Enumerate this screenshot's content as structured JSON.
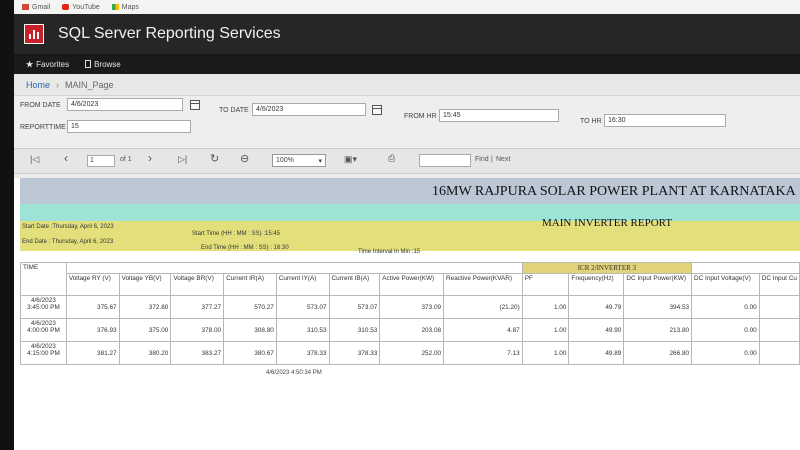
{
  "bookmarks": [
    "Gmail",
    "YouTube",
    "Maps"
  ],
  "app_title": "SQL Server Reporting Services",
  "nav": {
    "favorites": "Favorites",
    "browse": "Browse"
  },
  "breadcrumb": {
    "home": "Home",
    "current": "MAIN_Page"
  },
  "params": {
    "from_date_label": "FROM DATE",
    "from_date": "4/6/2023",
    "to_date_label": "TO DATE",
    "to_date": "4/6/2023",
    "from_hr_label": "FROM HR",
    "from_hr": "15:45",
    "to_hr_label": "TO HR",
    "to_hr": "16:30",
    "reporttime_label": "REPORTTIME",
    "reporttime": "15"
  },
  "toolbar": {
    "page": "1",
    "of": "of 1",
    "zoom": "100%",
    "find": "Find",
    "next": "Next",
    "sep": "|"
  },
  "report": {
    "title": "16MW RAJPURA SOLAR POWER PLANT AT KARNATAKA",
    "subtitle": "MAIN INVERTER  REPORT",
    "start_date": "Start Date :Thursday, April 6, 2023",
    "end_date": "End  Date : Thursday, April 6, 2023",
    "start_time": "Start Time (HH : MM : SS) :15:45",
    "end_time": "End Time (HH : MM : SS) : 16:30",
    "interval": "Time Interval in Min  :15",
    "group": "ICR 2/INVERTER 3",
    "columns": [
      "TIME",
      "Voltage RY (V)",
      "Voltage YB(V)",
      "Voltage BR(V)",
      "Current IR(A)",
      "Current IY(A)",
      "Current IB(A)",
      "Active Power(KW)",
      "Reactive Power(KVAR)",
      "PF",
      "Frequency(Hz)",
      "DC Input Power(KW)",
      "DC Input Voltage(V)",
      "DC Input Cu"
    ],
    "rows": [
      {
        "time": "4/6/2023 3:45:00 PM",
        "vry": "375.67",
        "vyb": "372.80",
        "vbr": "377.27",
        "ir": "570.27",
        "iy": "573.07",
        "ib": "573.07",
        "ap": "373.09",
        "rp": "(21.20)",
        "pf": "1.00",
        "freq": "49.79",
        "dcp": "394.53",
        "dcv": "0.00"
      },
      {
        "time": "4/6/2023 4:00:00 PM",
        "vry": "376.93",
        "vyb": "375.00",
        "vbr": "378.00",
        "ir": "308.80",
        "iy": "310.53",
        "ib": "310.53",
        "ap": "203.08",
        "rp": "4.87",
        "pf": "1.00",
        "freq": "49.90",
        "dcp": "213.80",
        "dcv": "0.00"
      },
      {
        "time": "4/6/2023 4:15:00 PM",
        "vry": "381.27",
        "vyb": "380.20",
        "vbr": "383.27",
        "ir": "380.67",
        "iy": "378.33",
        "ib": "378.33",
        "ap": "252.00",
        "rp": "7.13",
        "pf": "1.00",
        "freq": "49.89",
        "dcp": "266.80",
        "dcv": "0.00"
      }
    ],
    "generated": "4/6/2023 4:50:34 PM"
  },
  "colors": {
    "topbar": "#262626",
    "logo": "#c8202a",
    "title_band": "#bcc7d6",
    "sub_band": "#9ee4d6",
    "info_band": "#e3e07c"
  }
}
